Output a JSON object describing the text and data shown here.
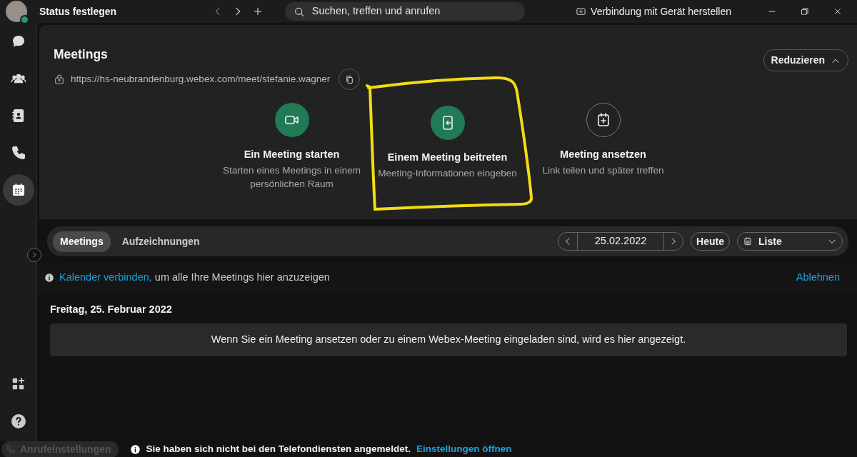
{
  "top_bar": {
    "status": "Status festlegen",
    "search": {
      "placeholder": "Suchen, treffen und anrufen"
    },
    "connect": "Verbindung mit Gerät herstellen"
  },
  "sidebar": {
    "items": [
      {
        "selected": false
      },
      {
        "selected": false
      },
      {
        "selected": false
      },
      {
        "selected": false
      },
      {
        "selected": true
      }
    ]
  },
  "meetings": {
    "title": "Meetings",
    "url": "https://hs-neubrandenburg.webex.com/meet/stefanie.wagner",
    "collapse": "Reduzieren",
    "actions": [
      {
        "title": "Ein Meeting starten",
        "subtitle": "Starten eines Meetings in einem persönlichen Raum",
        "highlighted": false
      },
      {
        "title": "Einem Meeting beitreten",
        "subtitle": "Meeting-Informationen eingeben",
        "highlighted": true
      },
      {
        "title": "Meeting ansetzen",
        "subtitle": "Link teilen und später treffen",
        "highlighted": false
      }
    ]
  },
  "tabs": [
    {
      "label": "Meetings",
      "selected": true
    },
    {
      "label": "Aufzeichnungen",
      "selected": false
    }
  ],
  "date": "25.02.2022",
  "today": "Heute",
  "view": "Liste",
  "notice": {
    "link": "Kalender verbinden,",
    "text": "um alle Ihre Meetings hier anzuzeigen",
    "dismiss": "Ablehnen"
  },
  "day_heading": "Freitag, 25. Februar 2022",
  "empty_message": "Wenn Sie ein Meeting ansetzen oder zu einem Webex-Meeting eingeladen sind, wird es hier angezeigt.",
  "status_bar": {
    "call_settings": "Anrufeinstellungen",
    "message": "Sie haben sich nicht bei den Telefondiensten angemeldet.",
    "link": "Einstellungen öffnen"
  }
}
